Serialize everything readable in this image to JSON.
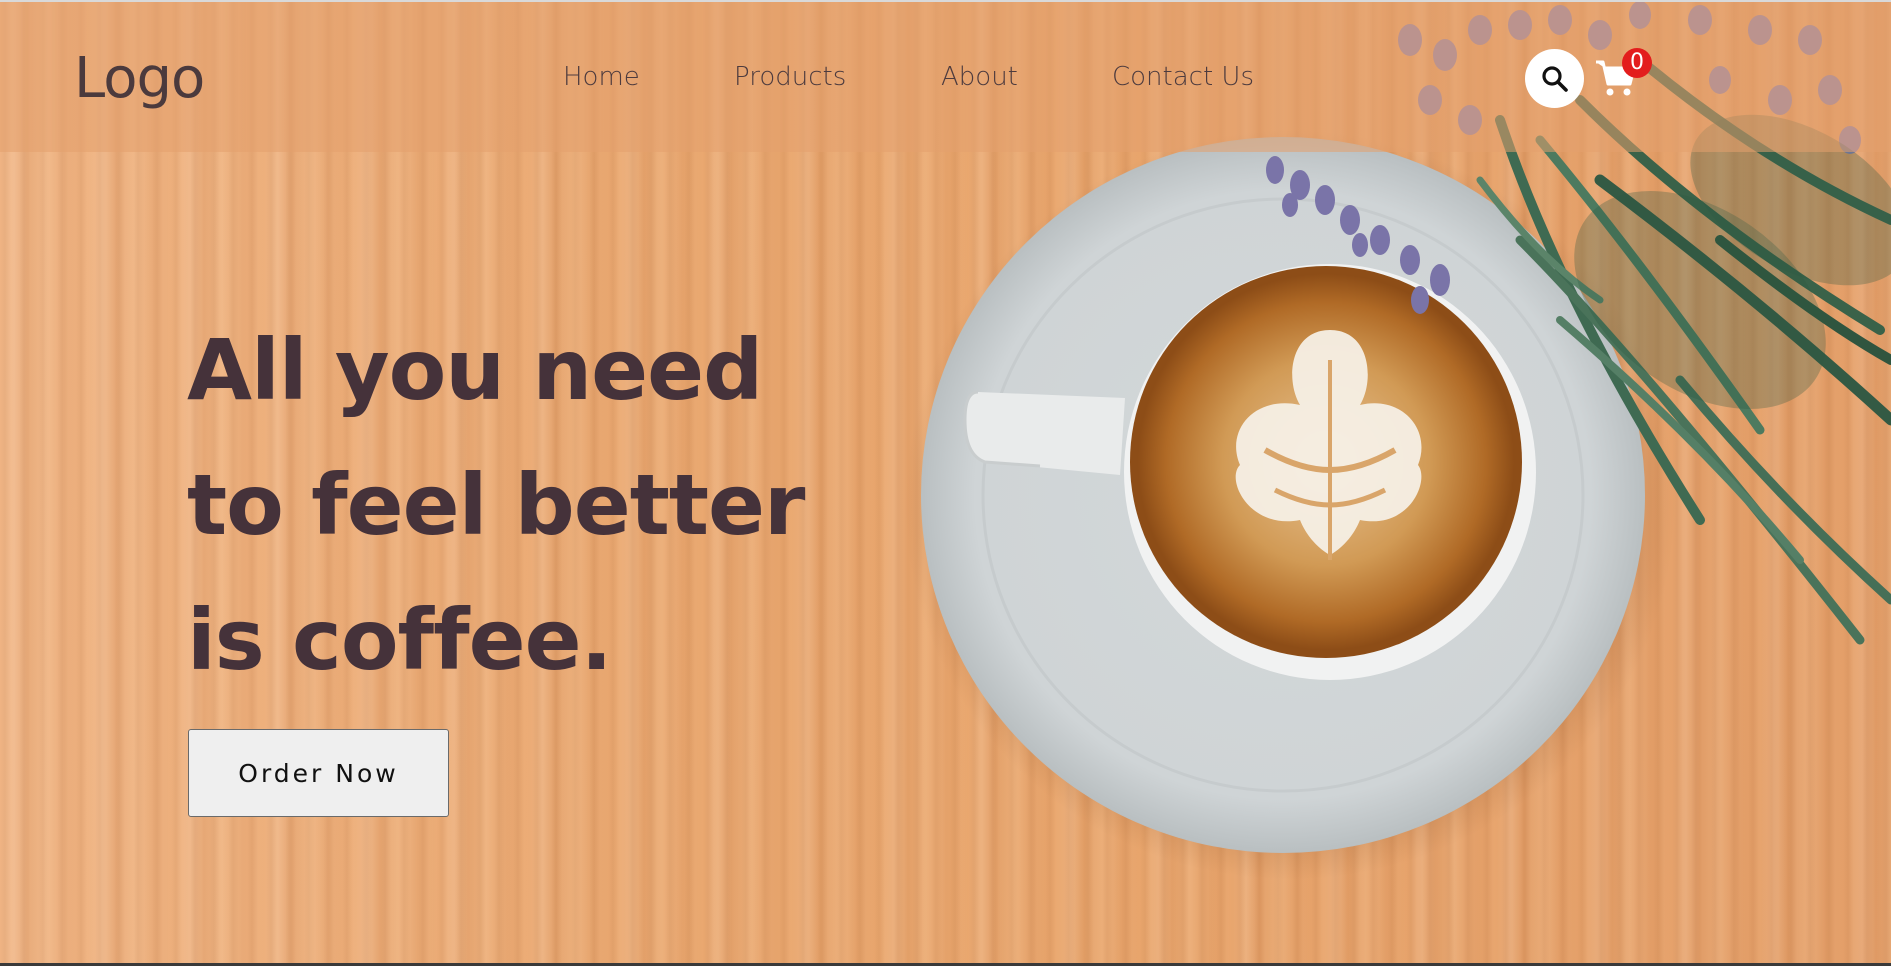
{
  "header": {
    "logo": "Logo",
    "nav": [
      {
        "label": "Home"
      },
      {
        "label": "Products"
      },
      {
        "label": "About"
      },
      {
        "label": "Contact Us"
      }
    ],
    "cart_count": "0"
  },
  "hero": {
    "headline_lines": [
      "All you need",
      "to feel better",
      "is coffee."
    ],
    "cta_label": "Order Now"
  },
  "colors": {
    "text": "#45323a",
    "badge": "#e31d1d",
    "wood": "#e9a66d"
  },
  "icons": [
    "search-icon",
    "cart-icon",
    "coffee-cup-image",
    "lavender-plant-image"
  ]
}
